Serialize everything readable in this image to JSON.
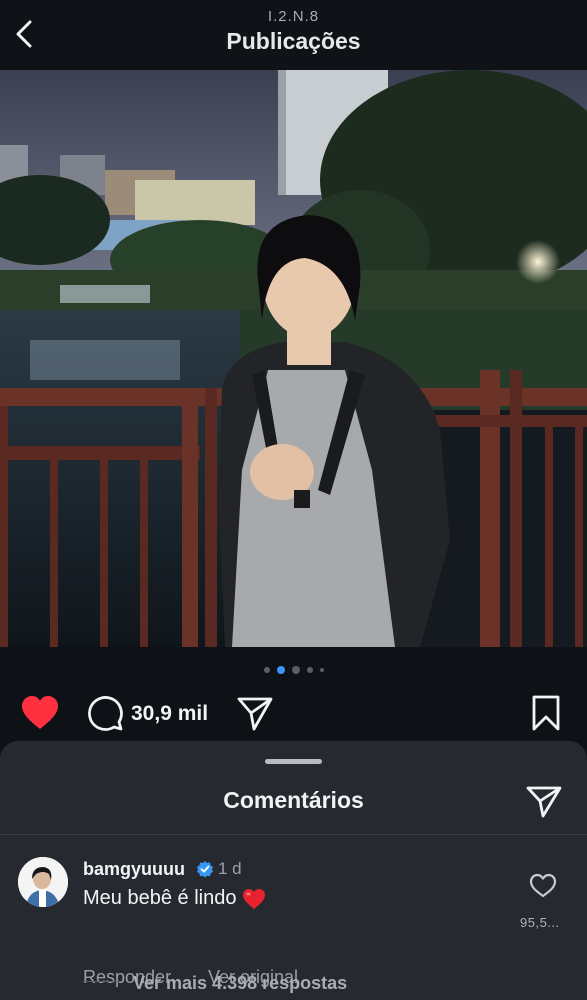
{
  "header": {
    "subtitle": "I.2.N.8",
    "title": "Publicações",
    "back_icon": "chevron-left-icon"
  },
  "post": {
    "carousel": {
      "total": 5,
      "active_index": 1
    },
    "actions": {
      "liked": true,
      "like_color": "#ff3040",
      "comment_count": "30,9 mil"
    }
  },
  "comments_sheet": {
    "title": "Comentários",
    "comment": {
      "username": "bamgyuuuu",
      "verified": true,
      "time": "1 d",
      "text": "Meu bebê é lindo",
      "emoji": "red-heart",
      "reply_label": "Responder",
      "translate_label": "Ver original",
      "like_count": "95,5..."
    },
    "more_replies": "Ver mais 4.398 respostas"
  },
  "colors": {
    "background": "#0e1116",
    "sheet": "#262a30",
    "accent": "#3897f0",
    "like": "#ff3040"
  }
}
